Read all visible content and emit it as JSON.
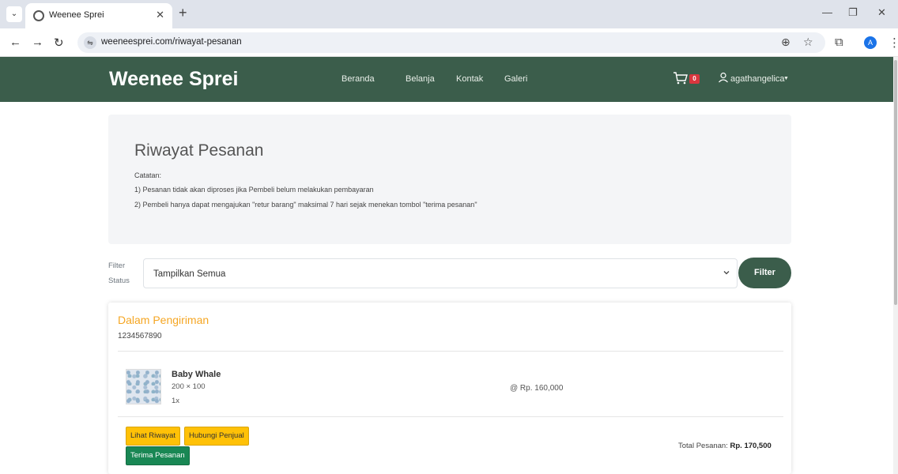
{
  "browser": {
    "tab_title": "Weenee Sprei",
    "url": "weeneesprei.com/riwayat-pesanan",
    "profile_initial": "A"
  },
  "site": {
    "brand": "Weenee Sprei",
    "nav": [
      "Beranda",
      "Belanja",
      "Kontak",
      "Galeri"
    ],
    "cart_count": "0",
    "username": "agathangelica"
  },
  "page": {
    "title": "Riwayat Pesanan",
    "notes_label": "Catatan:",
    "notes": [
      "1) Pesanan tidak akan diproses jika Pembeli belum melakukan pembayaran",
      "2) Pembeli hanya dapat mengajukan \"retur barang\" maksimal 7 hari sejak menekan tombol \"terima pesanan\""
    ]
  },
  "filter": {
    "label_line1": "Filter",
    "label_line2": "Status",
    "selected": "Tampilkan Semua",
    "button": "Filter"
  },
  "order": {
    "status": "Dalam Pengiriman",
    "order_id": "1234567890",
    "item": {
      "name": "Baby Whale",
      "size": "200 × 100",
      "qty": "1x",
      "price": "@ Rp. 160,000"
    },
    "buttons": {
      "history": "Lihat Riwayat",
      "contact_seller": "Hubungi Penjual",
      "receive": "Terima Pesanan"
    },
    "total_label": "Total Pesanan:",
    "total_value": "Rp. 170,500"
  },
  "colors": {
    "nav_green": "#3b5d4b",
    "status_orange": "#f5a623",
    "warning_yellow": "#ffc107",
    "success_green": "#198754"
  }
}
